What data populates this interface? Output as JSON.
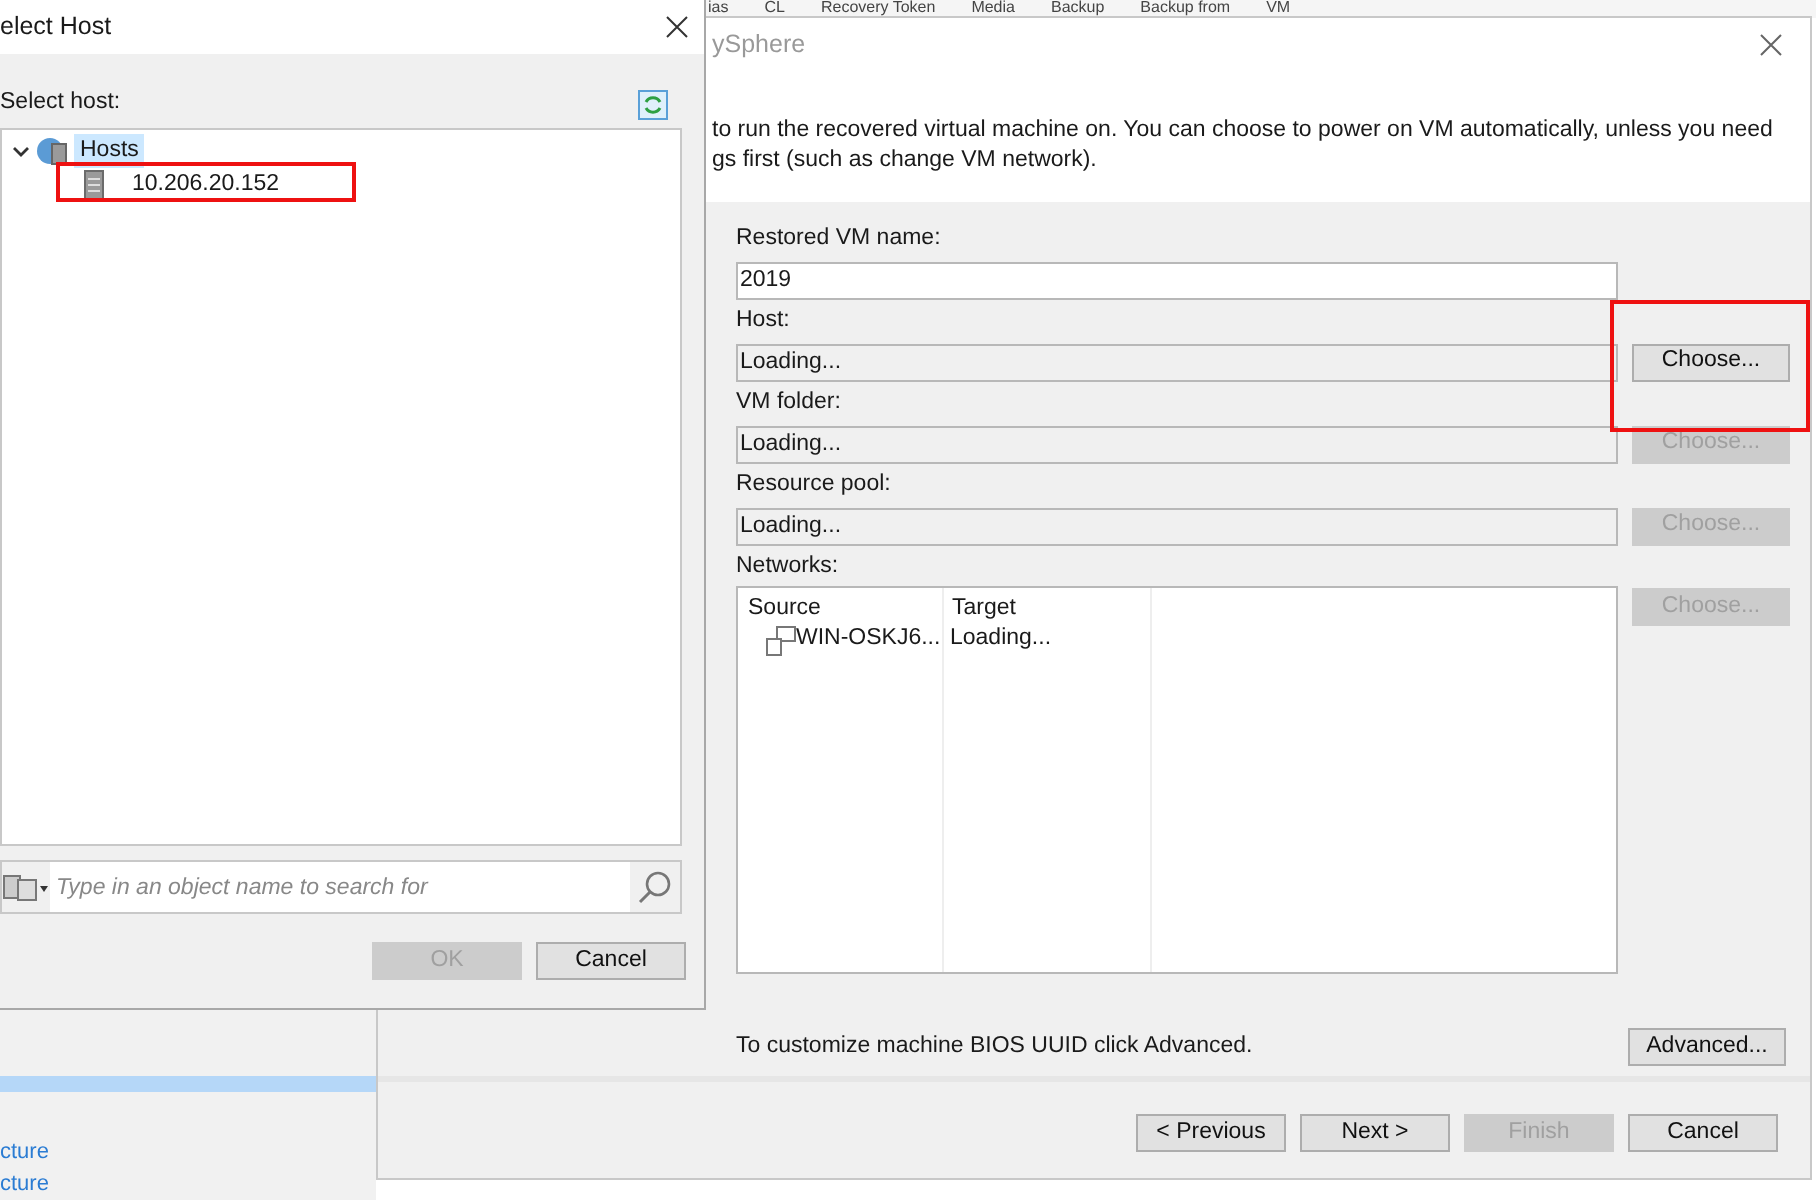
{
  "background_app": {
    "column_headers": [
      "ias",
      "CL",
      "Recovery Token",
      "Media",
      "Backup",
      "Backup from",
      "VM"
    ],
    "nav_links": [
      "cture",
      "cture"
    ]
  },
  "wizard": {
    "title": "ySphere",
    "description": [
      "to run the recovered virtual machine on. You can choose to power on VM automatically, unless you need",
      "gs first (such as change VM network)."
    ],
    "fields": [
      {
        "label": "Restored VM name:",
        "value": "2019",
        "loading": false
      },
      {
        "label": "Host:",
        "value": "Loading...",
        "loading": true,
        "button": {
          "label": "Choose...",
          "disabled": false
        }
      },
      {
        "label": "VM folder:",
        "value": "Loading...",
        "loading": true,
        "button": {
          "label": "Choose...",
          "disabled": true
        }
      },
      {
        "label": "Resource pool:",
        "value": "Loading...",
        "loading": true,
        "button": {
          "label": "Choose...",
          "disabled": true
        }
      }
    ],
    "networks": {
      "label": "Networks:",
      "columns": [
        "Source",
        "Target"
      ],
      "rows": [
        {
          "source": "WIN-OSKJ6...",
          "target": "Loading..."
        }
      ],
      "button": {
        "label": "Choose...",
        "disabled": true
      }
    },
    "advanced_hint": "To customize machine BIOS UUID click Advanced.",
    "advanced_button": {
      "label": "Advanced...",
      "disabled": false
    },
    "footer_buttons": [
      {
        "label": "< Previous",
        "disabled": false
      },
      {
        "label": "Next >",
        "disabled": false
      },
      {
        "label": "Finish",
        "disabled": true
      },
      {
        "label": "Cancel",
        "disabled": false
      }
    ]
  },
  "select_host_dialog": {
    "title": "elect Host",
    "prompt": "Select host:",
    "tree": [
      {
        "label": "Hosts",
        "expanded": true,
        "selected": true,
        "children": [
          {
            "label": "10.206.20.152",
            "selected": false
          }
        ]
      }
    ],
    "search": {
      "placeholder": "Type in an object name to search for"
    },
    "buttons": [
      {
        "label": "OK",
        "disabled": true
      },
      {
        "label": "Cancel",
        "disabled": false
      }
    ]
  }
}
